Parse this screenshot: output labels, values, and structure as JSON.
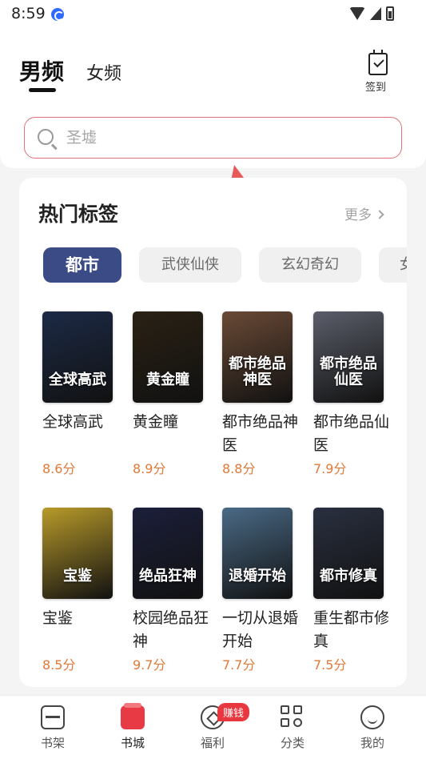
{
  "status_bar": {
    "time": "8:59"
  },
  "header": {
    "tab_male": "男频",
    "tab_female": "女频",
    "signin_label": "签到"
  },
  "search": {
    "placeholder": "圣墟"
  },
  "section": {
    "title": "热门标签",
    "more_label": "更多"
  },
  "tags": [
    {
      "label": "都市",
      "active": true
    },
    {
      "label": "武侠仙侠",
      "active": false
    },
    {
      "label": "玄幻奇幻",
      "active": false
    },
    {
      "label": "女",
      "active": false
    }
  ],
  "books": [
    {
      "title": "全球高武",
      "score": "8.6分",
      "cover_text": "全球高武",
      "cover_color": "#1c2a46"
    },
    {
      "title": "黄金瞳",
      "score": "8.9分",
      "cover_text": "黄金瞳",
      "cover_color": "#2a2114"
    },
    {
      "title": "都市绝品神医",
      "score": "8.8分",
      "cover_text": "都市绝品神医",
      "cover_color": "#6a4a36"
    },
    {
      "title": "都市绝品仙医",
      "score": "7.9分",
      "cover_text": "都市绝品仙医",
      "cover_color": "#5b5e6a"
    },
    {
      "title": "宝鉴",
      "score": "8.5分",
      "cover_text": "宝鉴",
      "cover_color": "#b89a2a"
    },
    {
      "title": "校园绝品狂神",
      "score": "9.7分",
      "cover_text": "绝品狂神",
      "cover_color": "#1b1f3a"
    },
    {
      "title": "一切从退婚开始",
      "score": "7.7分",
      "cover_text": "退婚开始",
      "cover_color": "#4a6a86"
    },
    {
      "title": "重生都市修真",
      "score": "7.5分",
      "cover_text": "都市修真",
      "cover_color": "#2a3040"
    }
  ],
  "nav": [
    {
      "label": "书架",
      "icon": "bookshelf-icon"
    },
    {
      "label": "书城",
      "icon": "bookstore-icon",
      "active": true
    },
    {
      "label": "福利",
      "icon": "welfare-icon"
    },
    {
      "label": "分类",
      "icon": "category-icon"
    },
    {
      "label": "我的",
      "icon": "mine-icon"
    }
  ],
  "nav_badge": "赚钱",
  "colors": {
    "accent": "#e83a45",
    "tag_active": "#3b4b86",
    "score": "#e07a3a",
    "search_border": "#e0707a"
  }
}
